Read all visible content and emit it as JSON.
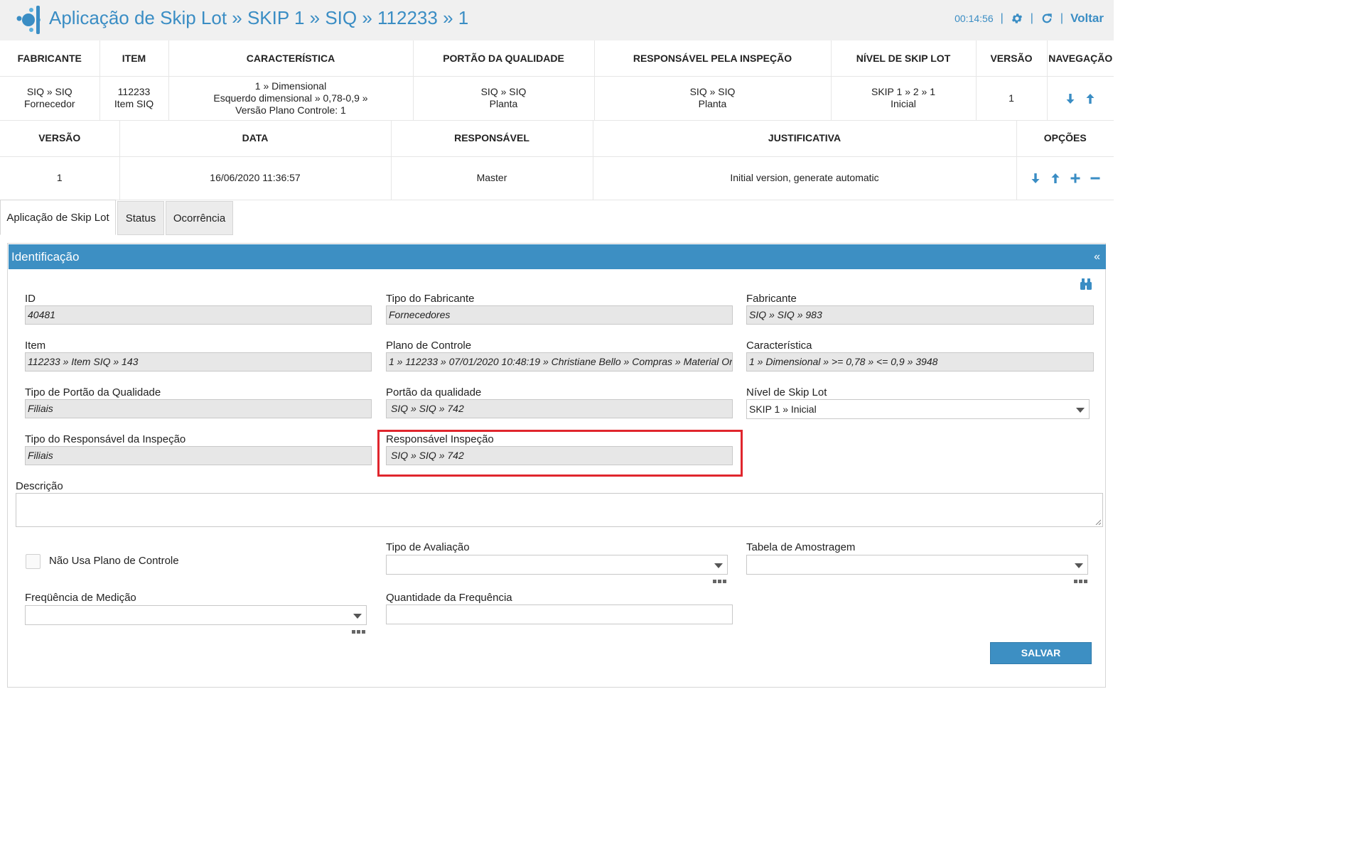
{
  "header": {
    "title": "Aplicação de Skip Lot » SKIP 1 » SIQ » 112233 » 1",
    "time": "00:14:56",
    "separator": "|",
    "back_label": "Voltar",
    "icons": [
      "app-logo-icon",
      "gear-icon",
      "refresh-icon"
    ]
  },
  "summary_table": {
    "headers": [
      "FABRICANTE",
      "ITEM",
      "CARACTERÍSTICA",
      "PORTÃO DA QUALIDADE",
      "RESPONSÁVEL PELA INSPEÇÃO",
      "NÍVEL DE SKIP LOT",
      "VERSÃO",
      "NAVEGAÇÃO"
    ],
    "row": {
      "fabricante": [
        "SIQ » SIQ",
        "Fornecedor"
      ],
      "item": [
        "112233",
        "Item SIQ"
      ],
      "caracteristica": [
        "1 » Dimensional",
        "Esquerdo dimensional » 0,78-0,9 »",
        "Versão Plano Controle: 1"
      ],
      "portao": [
        "SIQ » SIQ",
        "Planta"
      ],
      "responsavel": [
        "SIQ » SIQ",
        "Planta"
      ],
      "nivel": [
        "SKIP 1 » 2 » 1",
        "Inicial"
      ],
      "versao": "1"
    }
  },
  "version_table": {
    "headers": [
      "VERSÃO",
      "DATA",
      "RESPONSÁVEL",
      "JUSTIFICATIVA",
      "OPÇÕES"
    ],
    "row": {
      "versao": "1",
      "data": "16/06/2020 11:36:57",
      "responsavel": "Master",
      "justificativa": "Initial version, generate automatic"
    }
  },
  "tabs": [
    "Aplicação de Skip Lot",
    "Status",
    "Ocorrência"
  ],
  "active_tab": "Aplicação de Skip Lot",
  "panel": {
    "title": "Identificação",
    "collapse_glyph": "«"
  },
  "form": {
    "id": {
      "label": "ID",
      "value": "40481"
    },
    "tipo_fabricante": {
      "label": "Tipo do Fabricante",
      "value": "Fornecedores"
    },
    "fabricante": {
      "label": "Fabricante",
      "value": "SIQ » SIQ » 983"
    },
    "item": {
      "label": "Item",
      "value": "112233 » Item SIQ » 143"
    },
    "plano_controle": {
      "label": "Plano de Controle",
      "value": "1 » 112233 » 07/01/2020 10:48:19 » Christiane Bello » Compras » Material Ori"
    },
    "caracteristica": {
      "label": "Característica",
      "value": "1 » Dimensional » >= 0,78 » <= 0,9 » 3948"
    },
    "tipo_portao": {
      "label": "Tipo de Portão da Qualidade",
      "value": "Filiais"
    },
    "portao": {
      "label": "Portão da qualidade",
      "value": "SIQ  »  SIQ  » 742"
    },
    "nivel_skip": {
      "label": "Nível de Skip Lot",
      "value": "SKIP 1 » Inicial"
    },
    "tipo_responsavel": {
      "label": "Tipo do Responsável da Inspeção",
      "value": "Filiais"
    },
    "responsavel": {
      "label": "Responsável Inspeção",
      "value": "SIQ  »  SIQ  » 742"
    },
    "descricao": {
      "label": "Descrição",
      "value": ""
    },
    "nao_usa_plano": {
      "label": "Não Usa Plano de Controle",
      "checked": false
    },
    "tipo_avaliacao": {
      "label": "Tipo de Avaliação",
      "value": ""
    },
    "tabela_amostragem": {
      "label": "Tabela de Amostragem",
      "value": ""
    },
    "frequencia": {
      "label": "Freqüência de Medição",
      "value": ""
    },
    "quantidade": {
      "label": "Quantidade da Frequência",
      "value": ""
    },
    "save_label": "SALVAR"
  },
  "colors": {
    "accent": "#3a8dc4",
    "panel_header": "#3d8fc3",
    "highlight": "#e0262d",
    "readonly_field": "#e7e7e7"
  }
}
